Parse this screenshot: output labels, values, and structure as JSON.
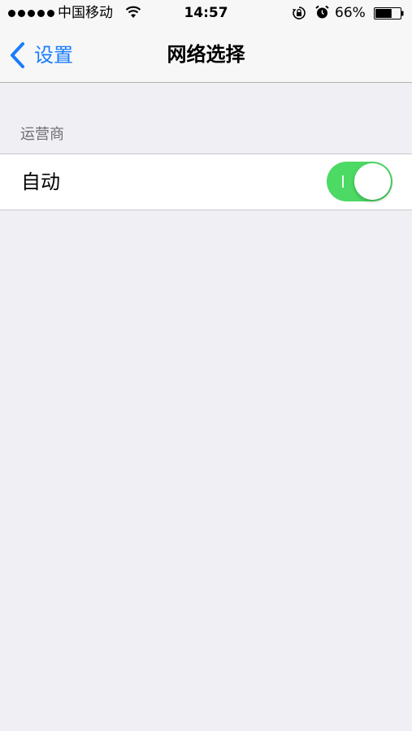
{
  "status_bar": {
    "carrier": "中国移动",
    "time": "14:57",
    "battery_percent": "66%",
    "battery_level": 0.66,
    "signal_bars": 5,
    "icons": [
      "signal-dots",
      "wifi-icon",
      "lock-rotation-icon",
      "alarm-icon",
      "battery-icon"
    ]
  },
  "nav": {
    "back_label": "设置",
    "title": "网络选择",
    "back_icon": "chevron-left-icon"
  },
  "section": {
    "header": "运营商"
  },
  "cell": {
    "label": "自动",
    "toggle_on": true
  },
  "colors": {
    "accent": "#1a7cfa",
    "toggle_on": "#4cd964",
    "background": "#efeff4",
    "section_header": "#6d6d72"
  }
}
